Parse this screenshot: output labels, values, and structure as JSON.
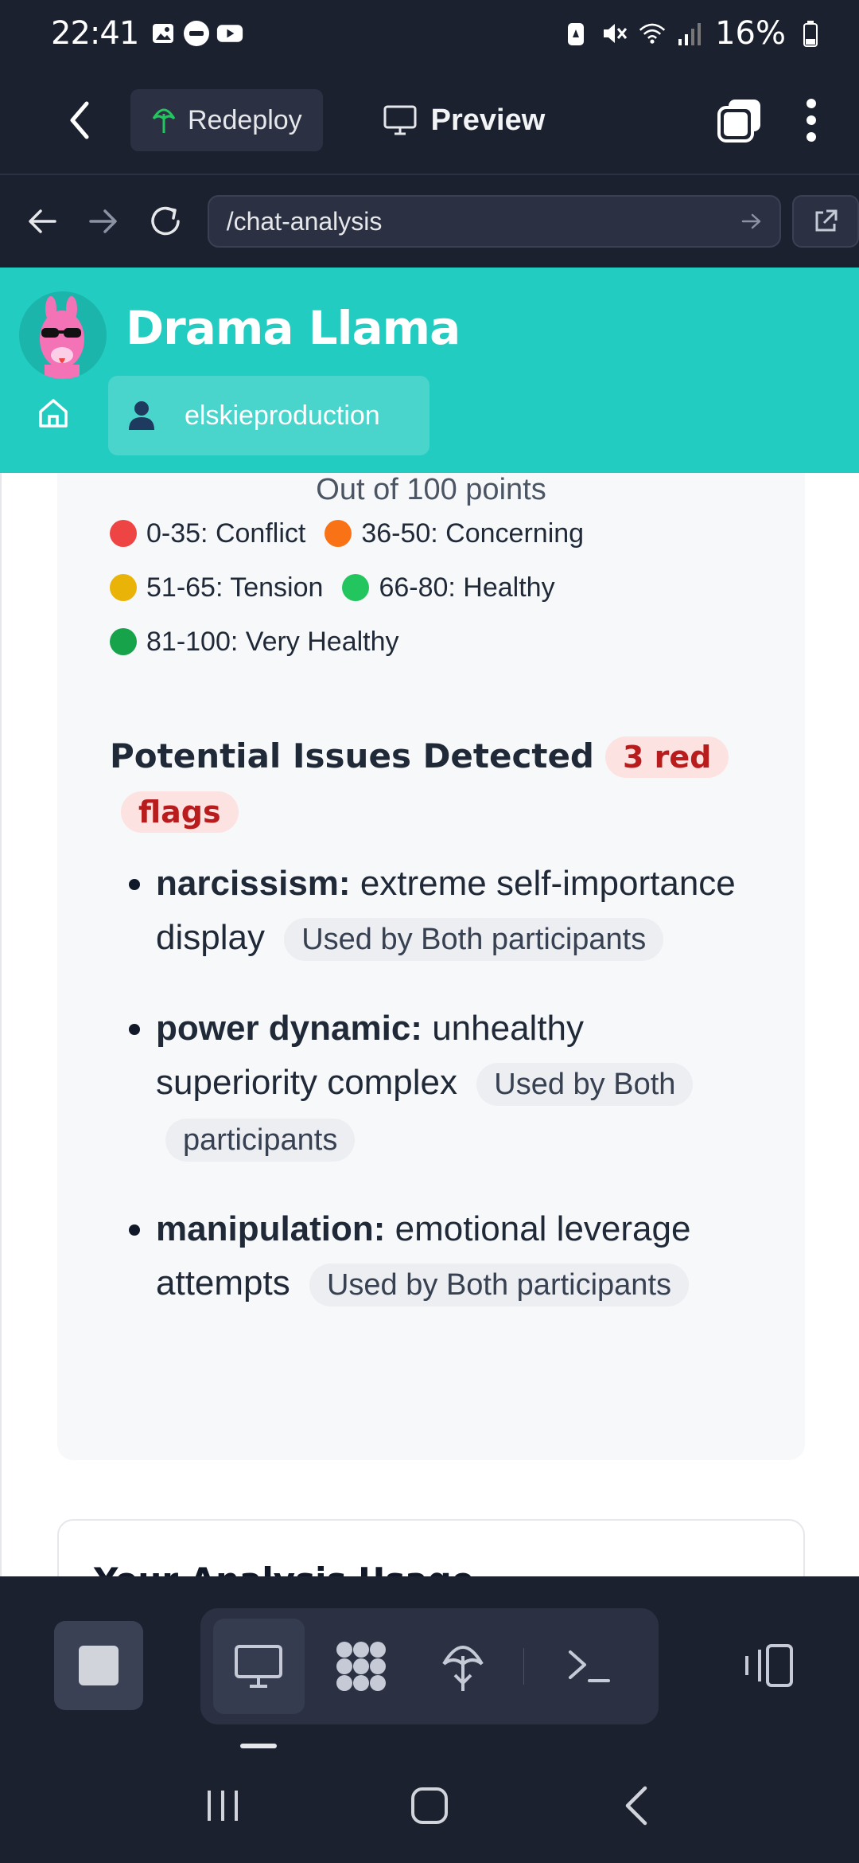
{
  "status_bar": {
    "time": "22:41",
    "battery": "16%"
  },
  "top_bar": {
    "redeploy_label": "Redeploy",
    "preview_label": "Preview"
  },
  "url_bar": {
    "url": "/chat-analysis"
  },
  "app": {
    "title": "Drama Llama",
    "username": "elskieproduction"
  },
  "score": {
    "note": "Out of 100 points",
    "legend": [
      {
        "label": "0-35: Conflict",
        "color": "#ef4444"
      },
      {
        "label": "36-50: Concerning",
        "color": "#f97316"
      },
      {
        "label": "51-65: Tension",
        "color": "#eab308"
      },
      {
        "label": "66-80: Healthy",
        "color": "#22c55e"
      },
      {
        "label": "81-100: Very Healthy",
        "color": "#16a34a"
      }
    ]
  },
  "issues": {
    "title": "Potential Issues Detected",
    "badge": "3 red flags",
    "items": [
      {
        "term": "narcissism:",
        "desc": "extreme self-importance display",
        "tag": "Used by Both participants"
      },
      {
        "term": "power dynamic:",
        "desc": "unhealthy superiority complex",
        "tag": "Used by Both participants"
      },
      {
        "term": "manipulation:",
        "desc": "emotional leverage attempts",
        "tag": "Used by Both participants"
      }
    ]
  },
  "next_card": {
    "title": "Your Analysis Usage"
  },
  "colors": {
    "accent": "#22ccc1",
    "dark_bg": "#1c2130",
    "flag_red": "#b91c1c"
  }
}
